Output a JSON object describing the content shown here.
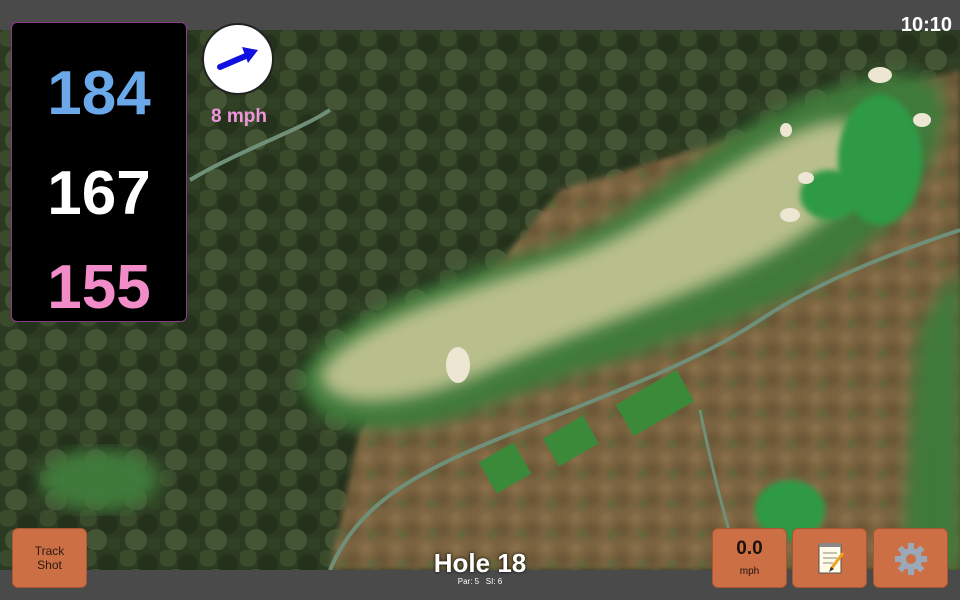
{
  "status": {
    "time": "10:10"
  },
  "distances": {
    "back": "184",
    "middle": "167",
    "front": "155"
  },
  "wind": {
    "speed": "8 mph",
    "icon": "wind-arrow-icon",
    "arrow_color": "#1010e0"
  },
  "hole": {
    "title": "Hole 18",
    "par": "Par: 5",
    "si": "SI: 6"
  },
  "buttons": {
    "track_shot": "Track\nShot",
    "speed_value": "0.0",
    "speed_unit": "mph",
    "notes_icon": "notepad-icon",
    "settings_icon": "gear-icon"
  },
  "colors": {
    "button": "#cd6f45",
    "back_distance": "#6aa8ea",
    "middle_distance": "#ffffff",
    "front_distance": "#f28cc8"
  }
}
